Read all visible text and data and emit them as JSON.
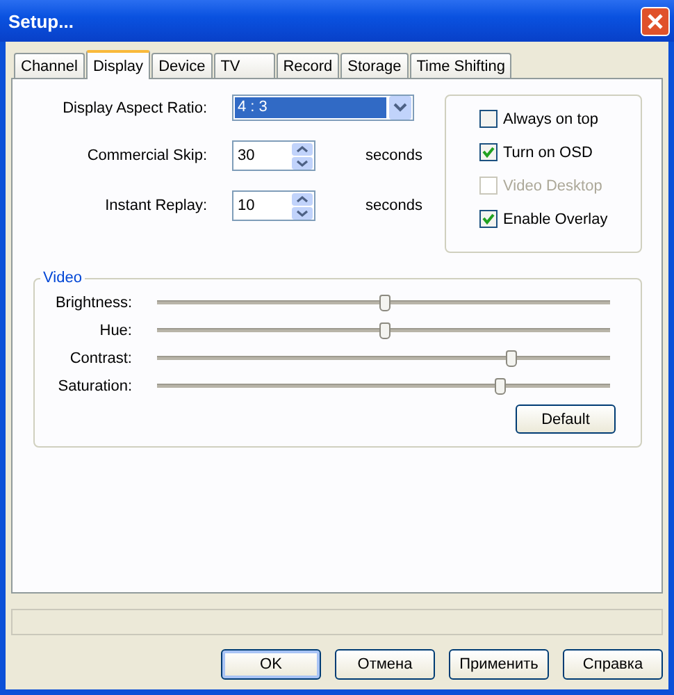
{
  "window": {
    "title": "Setup..."
  },
  "tabs": [
    {
      "label": "Channel",
      "selected": false
    },
    {
      "label": "Display",
      "selected": true
    },
    {
      "label": "Device",
      "selected": false
    },
    {
      "label": "TV",
      "selected": false
    },
    {
      "label": "Record",
      "selected": false
    },
    {
      "label": "Storage",
      "selected": false
    },
    {
      "label": "Time Shifting",
      "selected": false
    }
  ],
  "aspect_ratio": {
    "label": "Display Aspect Ratio:",
    "value": "4 : 3"
  },
  "spinners": [
    {
      "label": "Commercial Skip:",
      "value": "30",
      "unit": "seconds"
    },
    {
      "label": "Instant Replay:",
      "value": "10",
      "unit": "seconds"
    }
  ],
  "options": [
    {
      "label": "Always on top",
      "checked": false,
      "disabled": false
    },
    {
      "label": "Turn on OSD",
      "checked": true,
      "disabled": false
    },
    {
      "label": "Video Desktop",
      "checked": false,
      "disabled": true
    },
    {
      "label": "Enable Overlay",
      "checked": true,
      "disabled": false
    }
  ],
  "video": {
    "title": "Video",
    "sliders": [
      {
        "label": "Brightness:",
        "level": 0.5
      },
      {
        "label": "Hue:",
        "level": 0.5
      },
      {
        "label": "Contrast:",
        "level": 0.78
      },
      {
        "label": "Saturation:",
        "level": 0.755
      }
    ],
    "default_button": "Default"
  },
  "buttons": [
    {
      "label": "OK",
      "default": true
    },
    {
      "label": "Отмена",
      "default": false
    },
    {
      "label": "Применить",
      "default": false
    },
    {
      "label": "Справка",
      "default": false
    }
  ]
}
